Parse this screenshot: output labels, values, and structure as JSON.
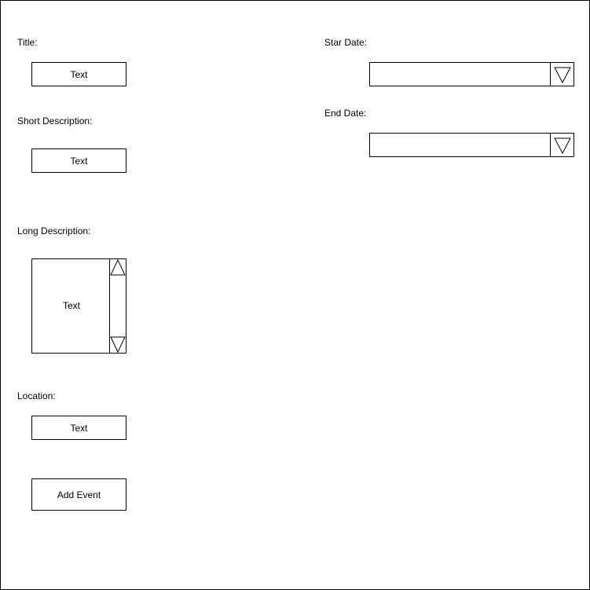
{
  "form": {
    "title_label": "Title:",
    "title_field": "Text",
    "short_description_label": "Short Description:",
    "short_description_field": "Text",
    "long_description_label": "Long Description:",
    "long_description_field": "Text",
    "location_label": "Location:",
    "location_field": "Text",
    "add_event_button": "Add Event",
    "start_date_label": "Star Date:",
    "start_date_value": "",
    "end_date_label": "End Date:",
    "end_date_value": ""
  },
  "icons": {
    "scroll_up": "triangle-up-icon",
    "scroll_down": "triangle-down-icon",
    "dropdown": "triangle-down-icon"
  },
  "colors": {
    "stroke": "#000000",
    "background": "#ffffff"
  }
}
